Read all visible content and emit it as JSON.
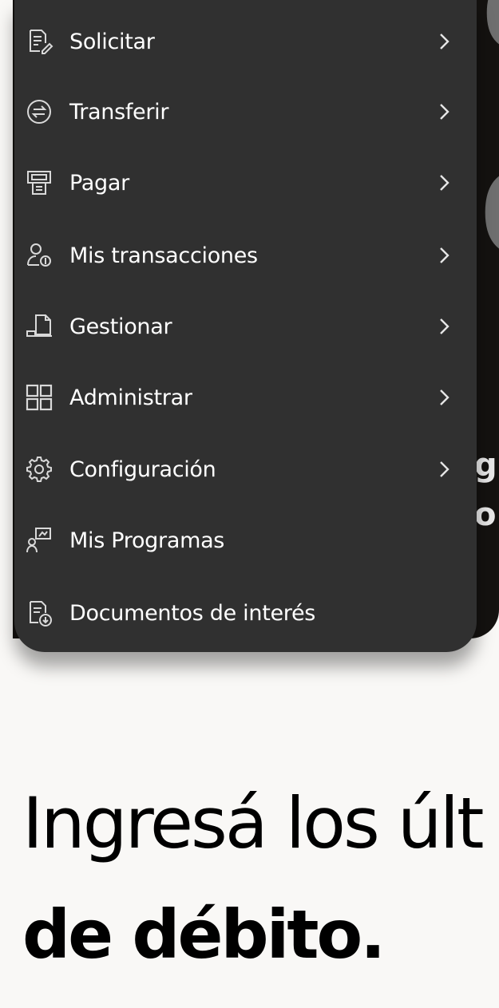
{
  "menu": {
    "items": [
      {
        "label": "Solicitar",
        "icon": "request-document-icon",
        "has_chevron": true
      },
      {
        "label": "Transferir",
        "icon": "transfer-icon",
        "has_chevron": true
      },
      {
        "label": "Pagar",
        "icon": "payment-terminal-icon",
        "has_chevron": true
      },
      {
        "label": "Mis transacciones",
        "icon": "user-transactions-icon",
        "has_chevron": true
      },
      {
        "label": "Gestionar",
        "icon": "manage-document-icon",
        "has_chevron": true
      },
      {
        "label": "Administrar",
        "icon": "grid-icon",
        "has_chevron": true
      },
      {
        "label": "Configuración",
        "icon": "gear-icon",
        "has_chevron": true
      },
      {
        "label": "Mis Programas",
        "icon": "programs-icon",
        "has_chevron": false
      },
      {
        "label": "Documentos de interés",
        "icon": "documents-download-icon",
        "has_chevron": false
      }
    ]
  },
  "background": {
    "partial_text_1": "g",
    "partial_text_2": "o"
  },
  "heading": {
    "line1": "Ingresá los últ",
    "line2": "de débito."
  },
  "colors": {
    "menu_bg": "#303030",
    "menu_text": "#ffffff",
    "page_bg": "#f9f8f6",
    "heading_text": "#000000"
  }
}
